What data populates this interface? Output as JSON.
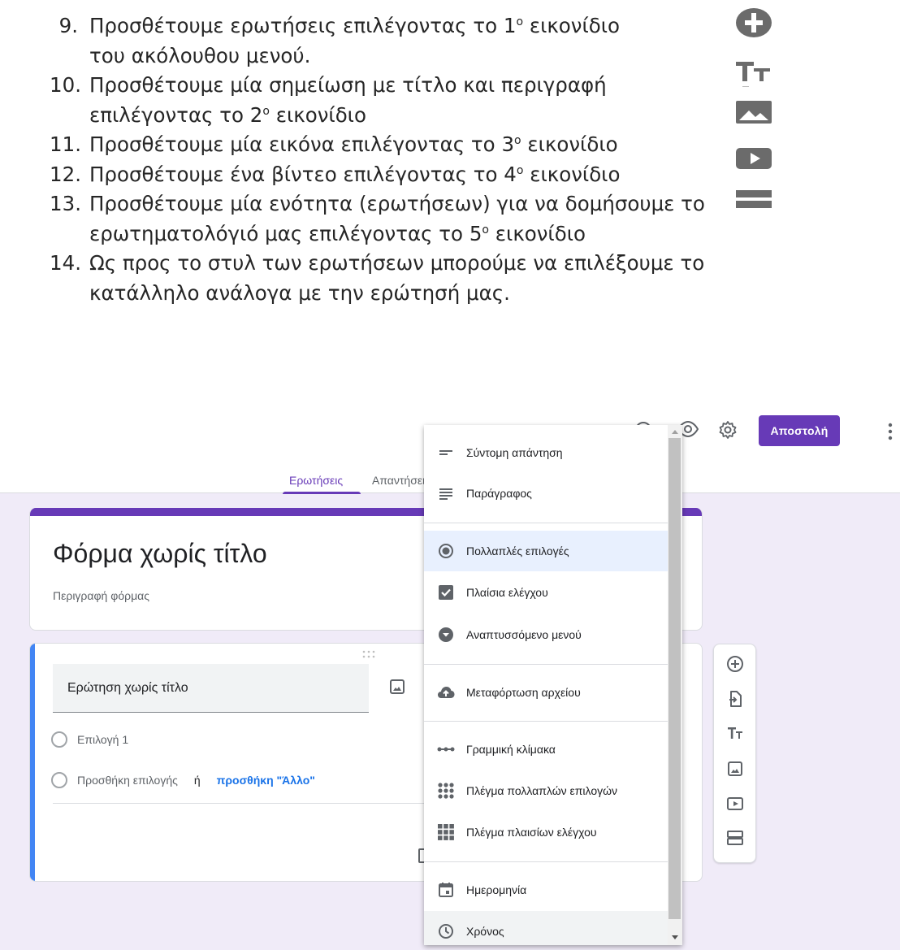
{
  "document": {
    "items": [
      {
        "num": "9.",
        "line1": "Προσθέτουμε ερωτήσεις επιλέγοντας το 1",
        "sup1": "ο",
        "line1_rest": " εικονίδιο",
        "line2": "του ακόλουθου μενού."
      },
      {
        "num": "10.",
        "line1": "Προσθέτουμε μία σημείωση με τίτλο και περιγραφή",
        "line2": "επιλέγοντας το 2",
        "sup2": "ο",
        "line2_rest": " εικονίδιο"
      },
      {
        "num": "11.",
        "line1": "Προσθέτουμε μία εικόνα επιλέγοντας το 3",
        "sup1": "ο",
        "line1_rest": " εικονίδιο"
      },
      {
        "num": "12.",
        "line1": "Προσθέτουμε ένα βίντεο επιλέγοντας το 4",
        "sup1": "ο",
        "line1_rest": " εικονίδιο"
      },
      {
        "num": "13.",
        "line1": "Προσθέτουμε μία ενότητα (ερωτήσεων) για να δομήσουμε το",
        "line2": "ερωτηματολόγιό μας επιλέγοντας το 5",
        "sup2": "ο",
        "line2_rest": " εικονίδιο"
      },
      {
        "num": "14.",
        "line1": "Ως προς το στυλ των ερωτήσεων μπορούμε να επιλέξουμε το",
        "line2": "κατάλληλο ανάλογα με την ερώτησή μας."
      }
    ]
  },
  "header": {
    "send_label": "Αποστολή"
  },
  "tabs": {
    "questions": "Ερωτήσεις",
    "responses": "Απαντήσεις"
  },
  "form": {
    "title": "Φόρμα χωρίς τίτλο",
    "description": "Περιγραφή φόρμας"
  },
  "question": {
    "title": "Ερώτηση χωρίς τίτλο",
    "option1": "Επιλογή 1",
    "add_option": "Προσθήκη επιλογής",
    "or": "ή",
    "add_other": "προσθήκη \"Άλλο\""
  },
  "menu": {
    "items": [
      {
        "label": "Σύντομη απάντηση",
        "icon": "short-answer-icon"
      },
      {
        "label": "Παράγραφος",
        "icon": "paragraph-icon"
      },
      {
        "label": "Πολλαπλές επιλογές",
        "icon": "radio-checked-icon",
        "selected": true
      },
      {
        "label": "Πλαίσια ελέγχου",
        "icon": "checkbox-icon"
      },
      {
        "label": "Αναπτυσσόμενο μενού",
        "icon": "dropdown-icon"
      },
      {
        "label": "Μεταφόρτωση αρχείου",
        "icon": "cloud-upload-icon"
      },
      {
        "label": "Γραμμική κλίμακα",
        "icon": "linear-scale-icon"
      },
      {
        "label": "Πλέγμα πολλαπλών επιλογών",
        "icon": "grid-dots-icon"
      },
      {
        "label": "Πλέγμα πλαισίων ελέγχου",
        "icon": "grid-squares-icon"
      },
      {
        "label": "Ημερομηνία",
        "icon": "calendar-icon"
      },
      {
        "label": "Χρόνος",
        "icon": "clock-icon"
      }
    ]
  },
  "colors": {
    "accent": "#673ab7",
    "question_bar": "#4285f4",
    "background": "#f0ebf8",
    "link": "#1a73e8"
  }
}
